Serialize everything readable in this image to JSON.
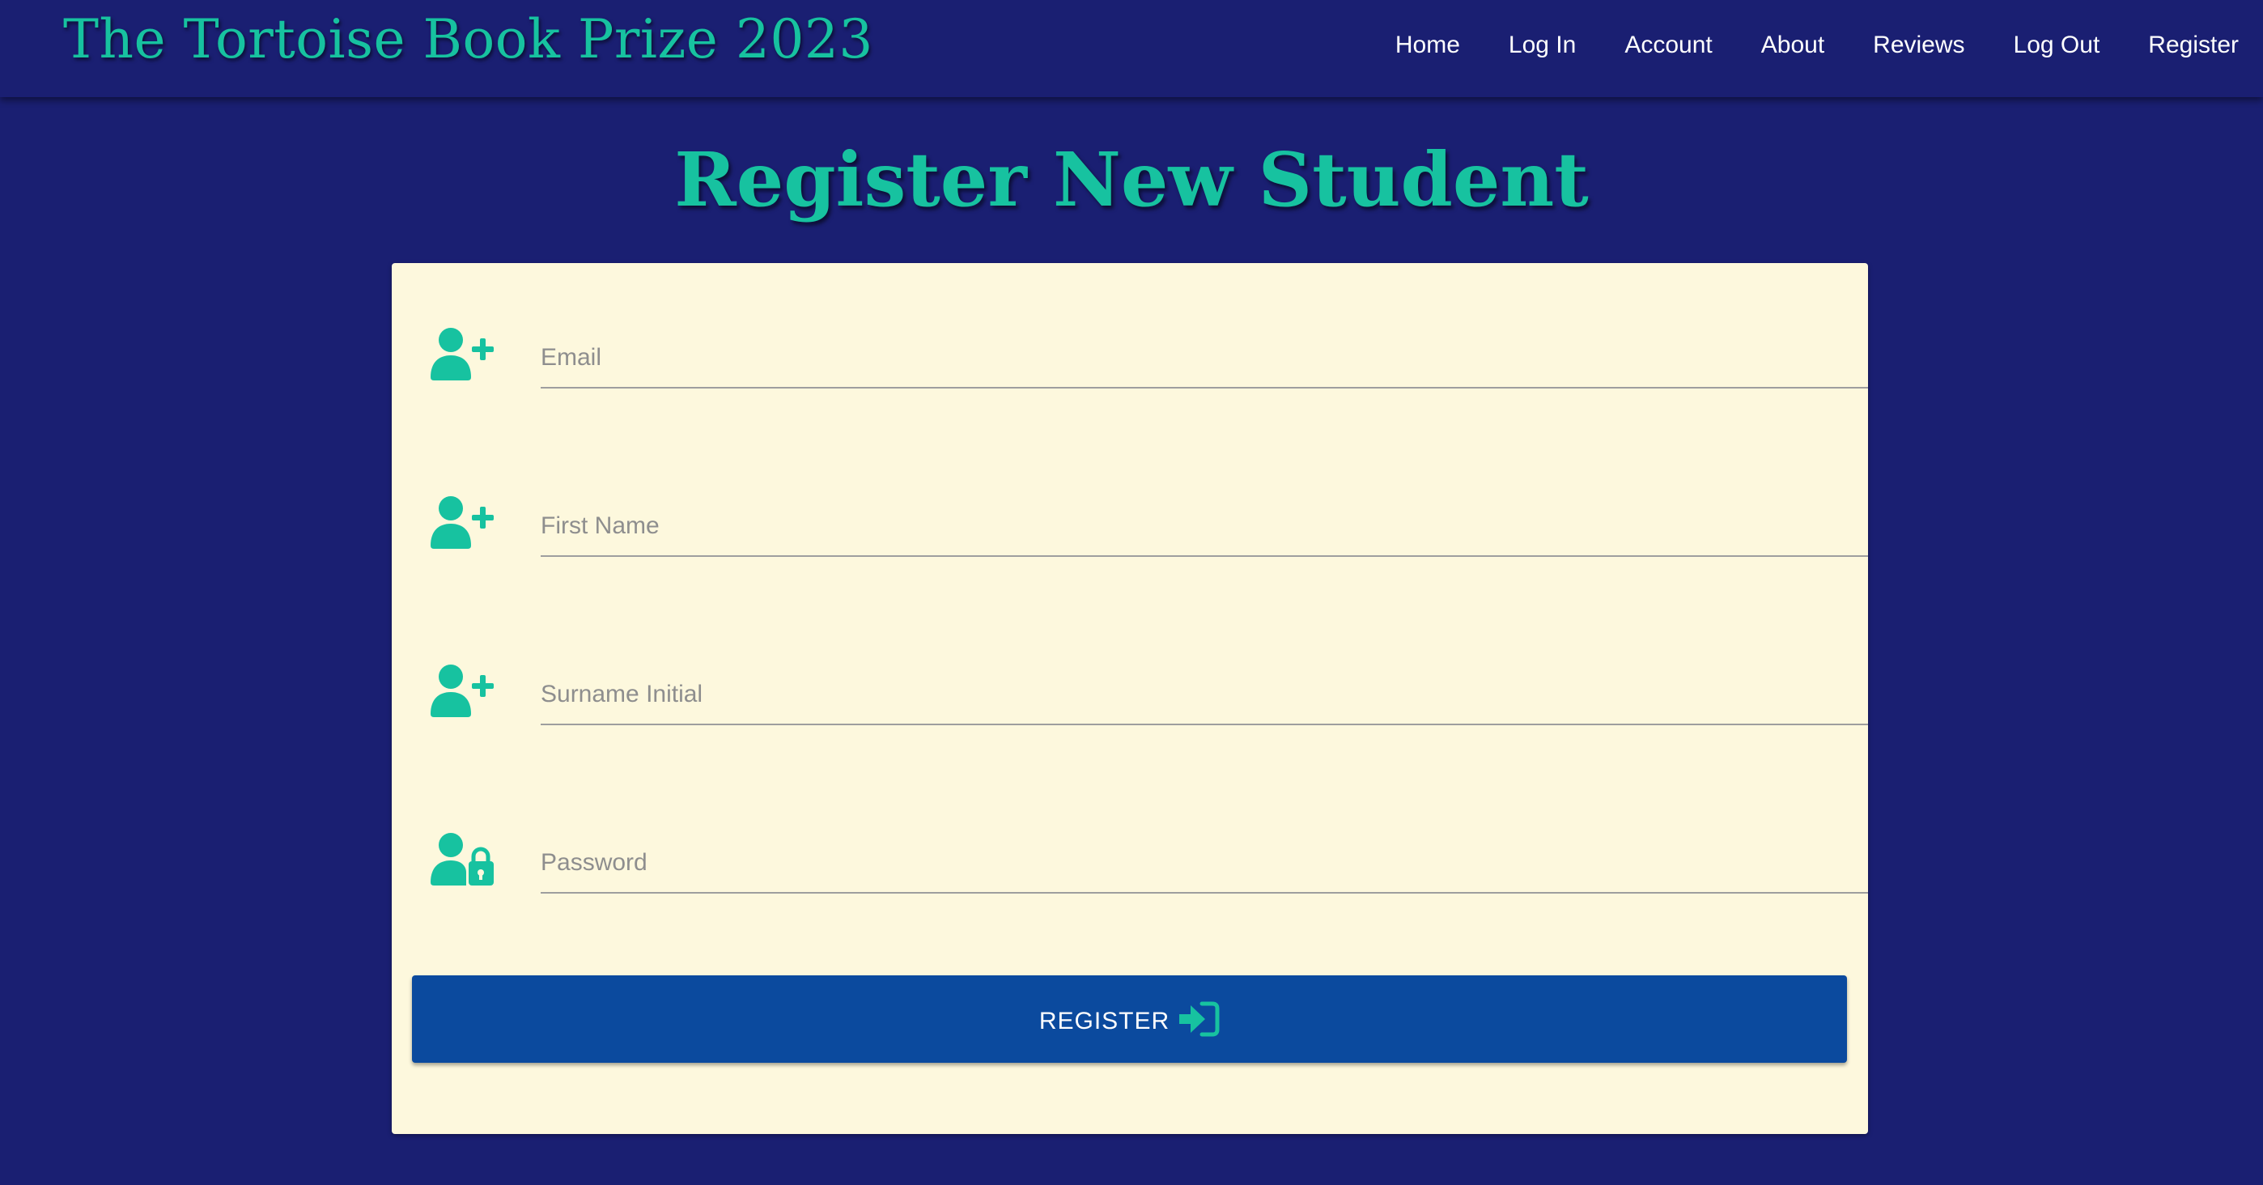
{
  "header": {
    "brand": "The Tortoise Book Prize 2023",
    "nav": [
      {
        "label": "Home"
      },
      {
        "label": "Log In"
      },
      {
        "label": "Account"
      },
      {
        "label": "About"
      },
      {
        "label": "Reviews"
      },
      {
        "label": "Log Out"
      },
      {
        "label": "Register"
      }
    ]
  },
  "page": {
    "title": "Register New Student"
  },
  "form": {
    "fields": [
      {
        "placeholder": "Email",
        "value": "",
        "icon": "user-plus-icon"
      },
      {
        "placeholder": "First Name",
        "value": "",
        "icon": "user-plus-icon"
      },
      {
        "placeholder": "Surname Initial",
        "value": "",
        "icon": "user-plus-icon"
      },
      {
        "placeholder": "Password",
        "value": "",
        "icon": "user-lock-icon"
      }
    ],
    "submit_label": "REGISTER",
    "submit_icon": "sign-in-icon"
  },
  "colors": {
    "background": "#1a1f72",
    "accent": "#17c2a0",
    "card": "#fdf8dd",
    "button": "#0b4a9e"
  }
}
